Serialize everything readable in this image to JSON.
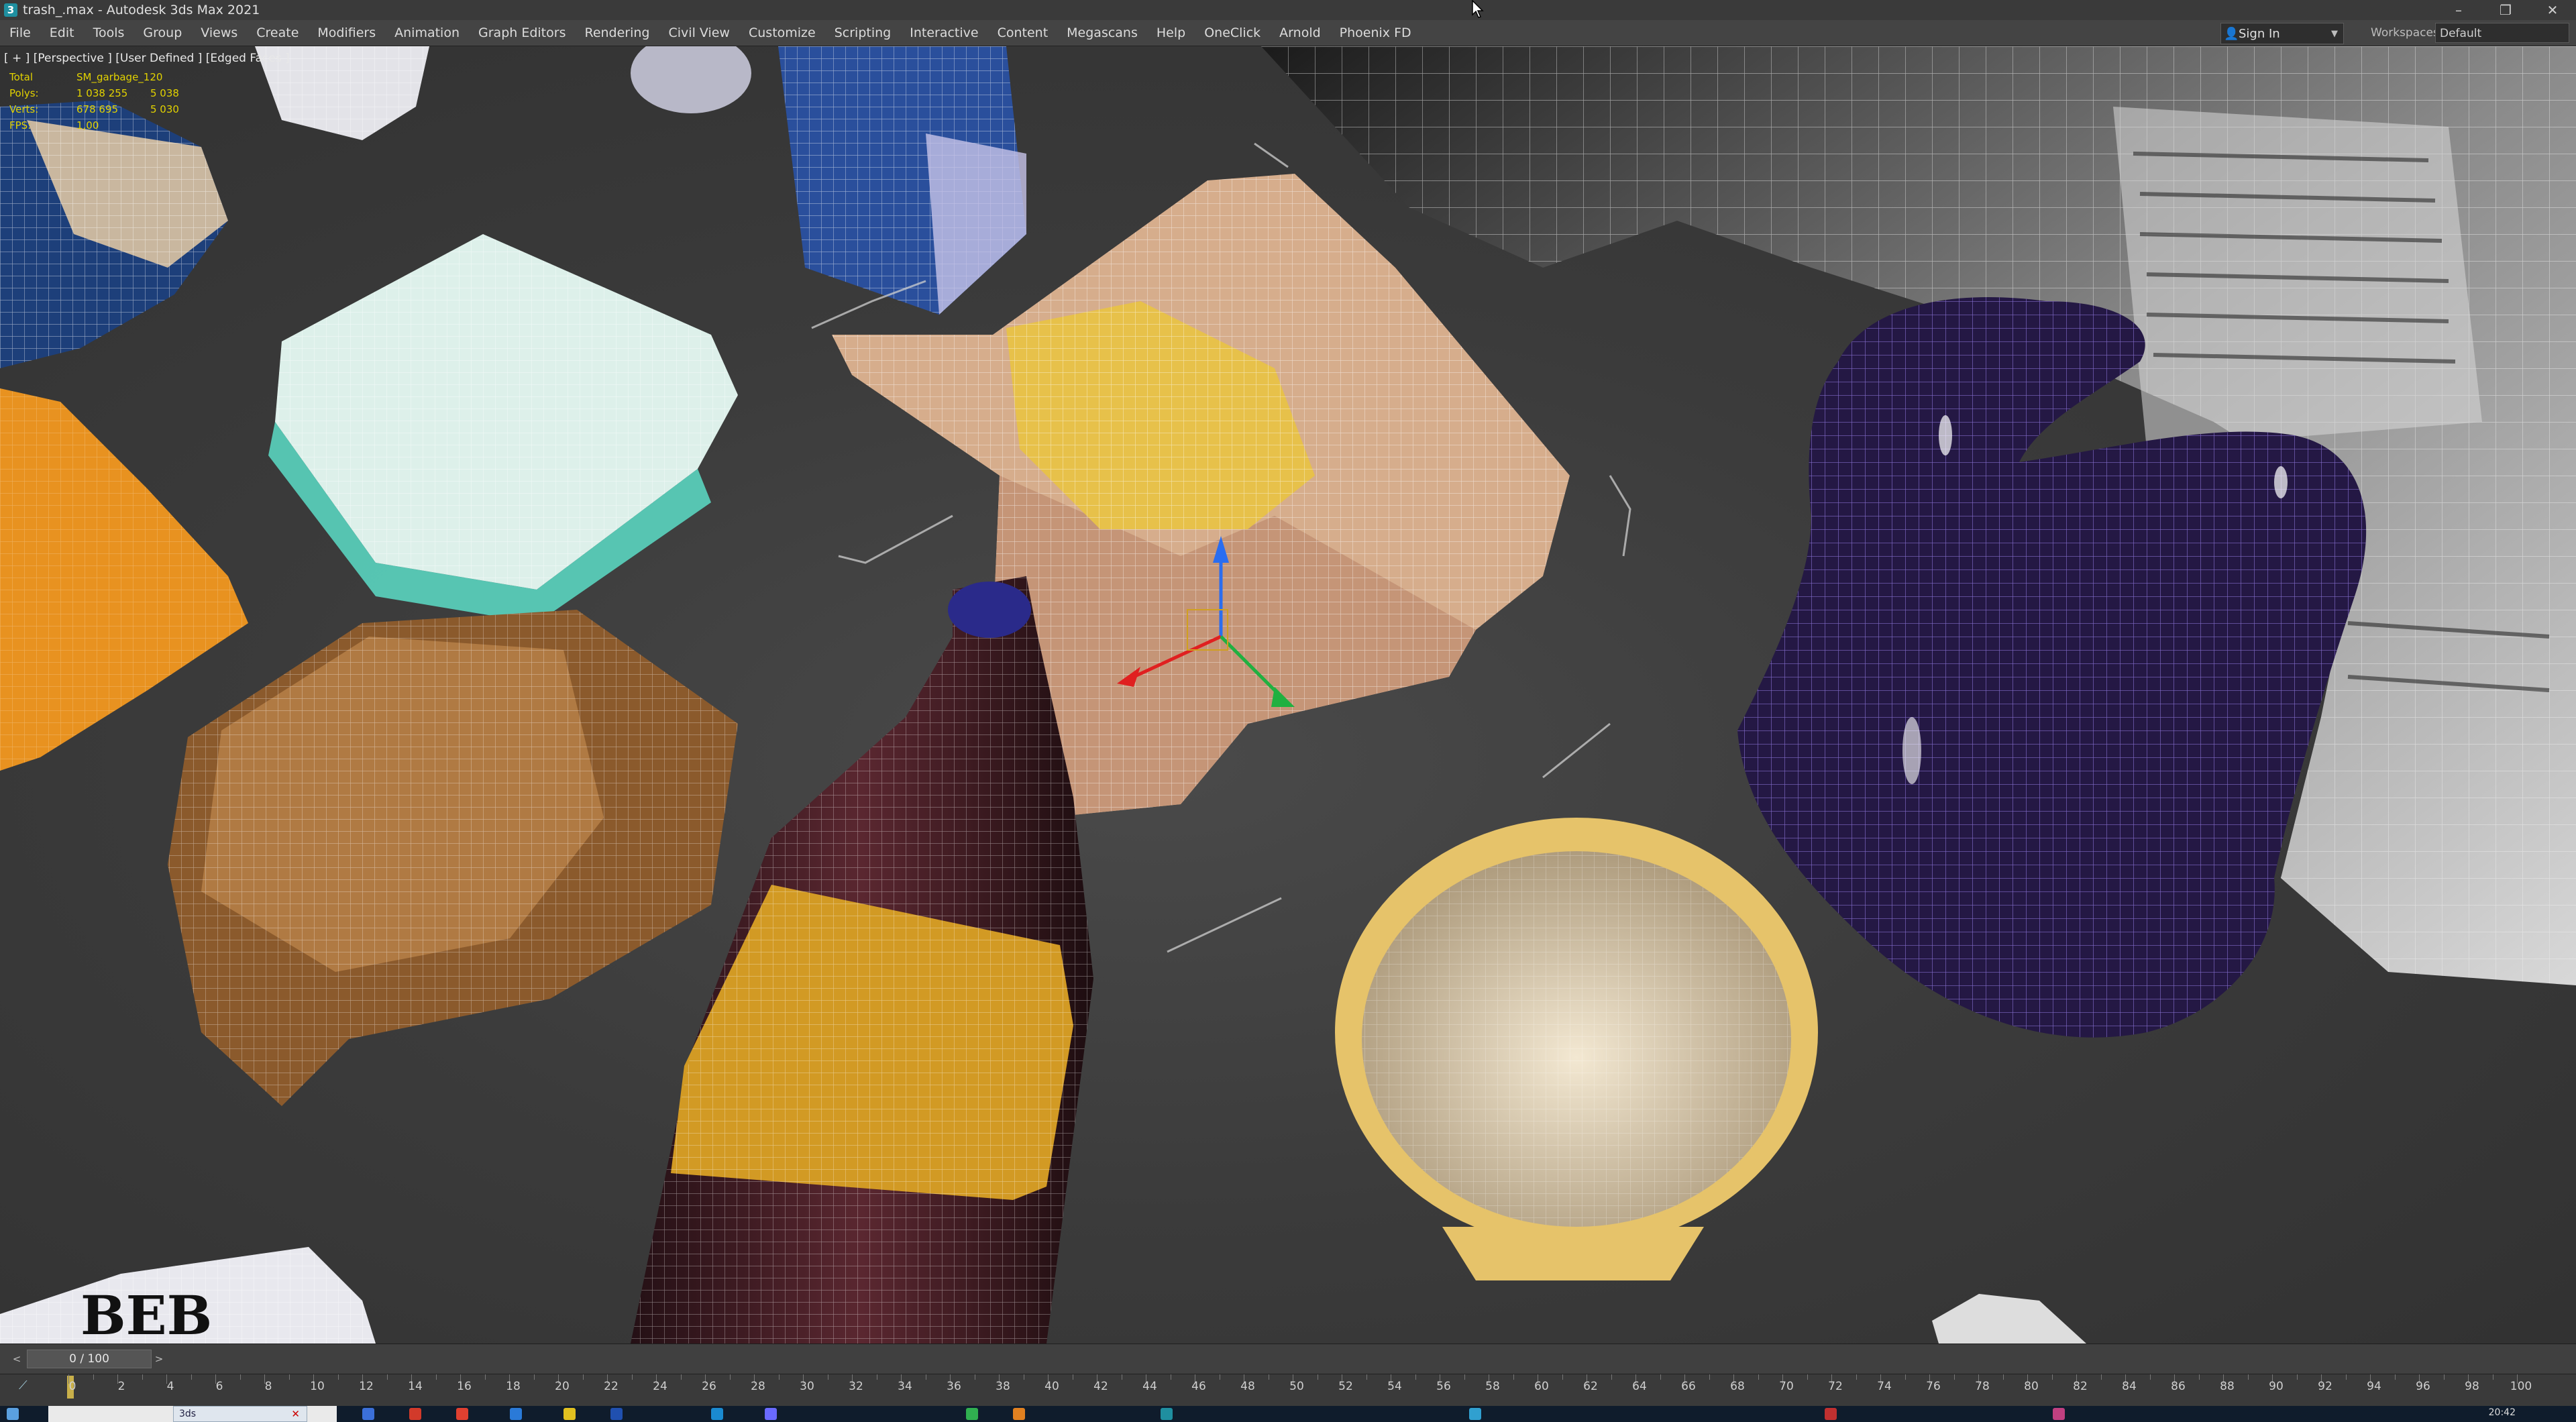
{
  "window": {
    "title": "trash_.max - Autodesk 3ds Max 2021",
    "app_icon": "3",
    "controls": [
      "–",
      "❐",
      "✕"
    ]
  },
  "menubar": {
    "items": [
      "File",
      "Edit",
      "Tools",
      "Group",
      "Views",
      "Create",
      "Modifiers",
      "Animation",
      "Graph Editors",
      "Rendering",
      "Civil View",
      "Customize",
      "Scripting",
      "Interactive",
      "Content",
      "Megascans",
      "Help",
      "OneClick",
      "Arnold",
      "Phoenix FD"
    ],
    "sign_in": "Sign In",
    "workspaces_label": "Workspaces:",
    "workspaces_value": "Default"
  },
  "viewport": {
    "label": "[ + ] [Perspective ] [User Defined ] [Edged Faces ]",
    "stats": [
      {
        "key": "Total",
        "value": "SM_garbage_120"
      },
      {
        "key": "Polys:",
        "value": "1 038 255",
        "value2": "5 038"
      },
      {
        "key": "Verts:",
        "value": "678 695",
        "value2": "5 030"
      },
      {
        "key": "FPS:",
        "value": "1,00"
      }
    ]
  },
  "timeslider": {
    "frame_display": "0 / 100",
    "prev_arrow": "<",
    "next_arrow": ">"
  },
  "trackbar": {
    "ticks": [
      "0",
      "2",
      "4",
      "6",
      "8",
      "10",
      "12",
      "14",
      "16",
      "18",
      "20",
      "22",
      "24",
      "26",
      "28",
      "30",
      "32",
      "34",
      "36",
      "38",
      "40",
      "42",
      "44",
      "46",
      "48",
      "50",
      "52",
      "54",
      "56",
      "58",
      "60",
      "62",
      "64",
      "66",
      "68",
      "70",
      "72",
      "74",
      "76",
      "78",
      "80",
      "82",
      "84",
      "86",
      "88",
      "90",
      "92",
      "94",
      "96",
      "98",
      "100"
    ]
  },
  "taskbar": {
    "clock": "20:42",
    "max_tab_label": "3ds"
  },
  "icons": {
    "app": "3ds-max-icon",
    "user": "user-icon",
    "cursor": "mouse-cursor-icon",
    "gizmo": "transform-gizmo-icon"
  }
}
